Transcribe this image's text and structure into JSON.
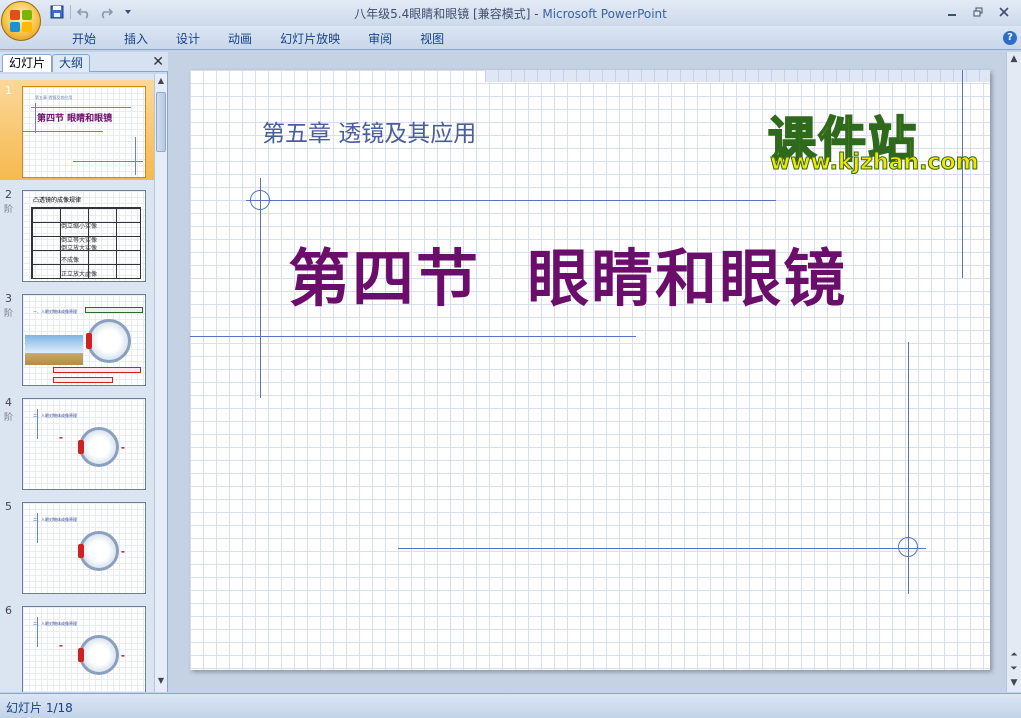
{
  "window": {
    "title": "八年级5.4眼睛和眼镜 [兼容模式] - ",
    "app_name": "Microsoft PowerPoint"
  },
  "quick_access": {
    "icons": [
      "save-icon",
      "undo-icon",
      "redo-icon",
      "customize-icon"
    ]
  },
  "ribbon": {
    "tabs": [
      "开始",
      "插入",
      "设计",
      "动画",
      "幻灯片放映",
      "审阅",
      "视图"
    ]
  },
  "left_panel": {
    "tab_slides": "幻灯片",
    "tab_outline": "大纲",
    "close": "✕",
    "thumbnails": [
      {
        "number": "1",
        "title": "第四节  眼睛和眼镜",
        "subtitle": "第五章 透镜及其应用"
      },
      {
        "number": "2",
        "heading": "凸透镜的成像规律",
        "cells": [
          "倒立缩小实像",
          "倒立等大实像",
          "倒立放大实像",
          "不成像",
          "正立放大虚像"
        ]
      },
      {
        "number": "3",
        "heading": "一、人眼对物体成像原理"
      },
      {
        "number": "4",
        "heading": "二、人眼对物体成像原理"
      },
      {
        "number": "5",
        "heading": "二、人眼对物体成像原理"
      },
      {
        "number": "6",
        "heading": "二、人眼对物体成像原理"
      }
    ],
    "anim_marker": "阶"
  },
  "slide": {
    "subtitle": "第五章 透镜及其应用",
    "title": "第四节  眼睛和眼镜",
    "watermark_cn": "课件站",
    "watermark_url": "www.kjzhan.com"
  },
  "status": {
    "slide_counter": "幻灯片 1/18"
  },
  "colors": {
    "title_purple": "#6b0d6b",
    "subtitle_blue": "#4a5f97",
    "line_blue": "#5a72c4",
    "watermark_yellow": "#f7e300"
  }
}
